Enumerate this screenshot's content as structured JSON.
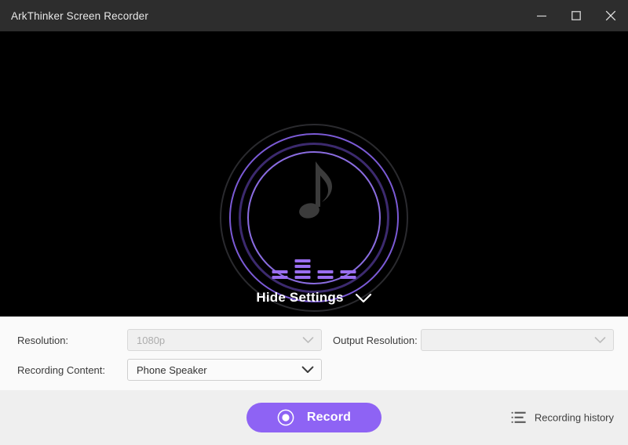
{
  "window": {
    "title": "ArkThinker Screen Recorder",
    "controls": {
      "minimize": "Minimize",
      "maximize": "Maximize",
      "close": "Close"
    }
  },
  "stage": {
    "mode_icon": "music-note-icon",
    "equalizer": {
      "columns": [
        2,
        4,
        2,
        2
      ]
    },
    "hide_settings_label": "Hide Settings",
    "hide_settings_chevron": "chevron-down-icon"
  },
  "settings": {
    "resolution": {
      "label": "Resolution:",
      "value": "1080p",
      "placeholder": "",
      "disabled": true
    },
    "output_resolution": {
      "label": "Output Resolution:",
      "value": "",
      "placeholder": "",
      "disabled": true
    },
    "recording_content": {
      "label": "Recording Content:",
      "value": "Phone Speaker",
      "placeholder": "",
      "disabled": false
    }
  },
  "footer": {
    "record_label": "Record",
    "record_icon": "record-dot-icon",
    "history_label": "Recording history",
    "history_icon": "list-lines-icon"
  },
  "colors": {
    "titlebar": "#2d2d2d",
    "stage": "#000000",
    "accent_purple": "#8e63f4",
    "ring_bright": "#8a6ce0",
    "ring_deep": "#3c2a6e",
    "equalizer": "#9a6ef0",
    "panel": "#fafafa",
    "bottom_bar": "#efefef"
  }
}
